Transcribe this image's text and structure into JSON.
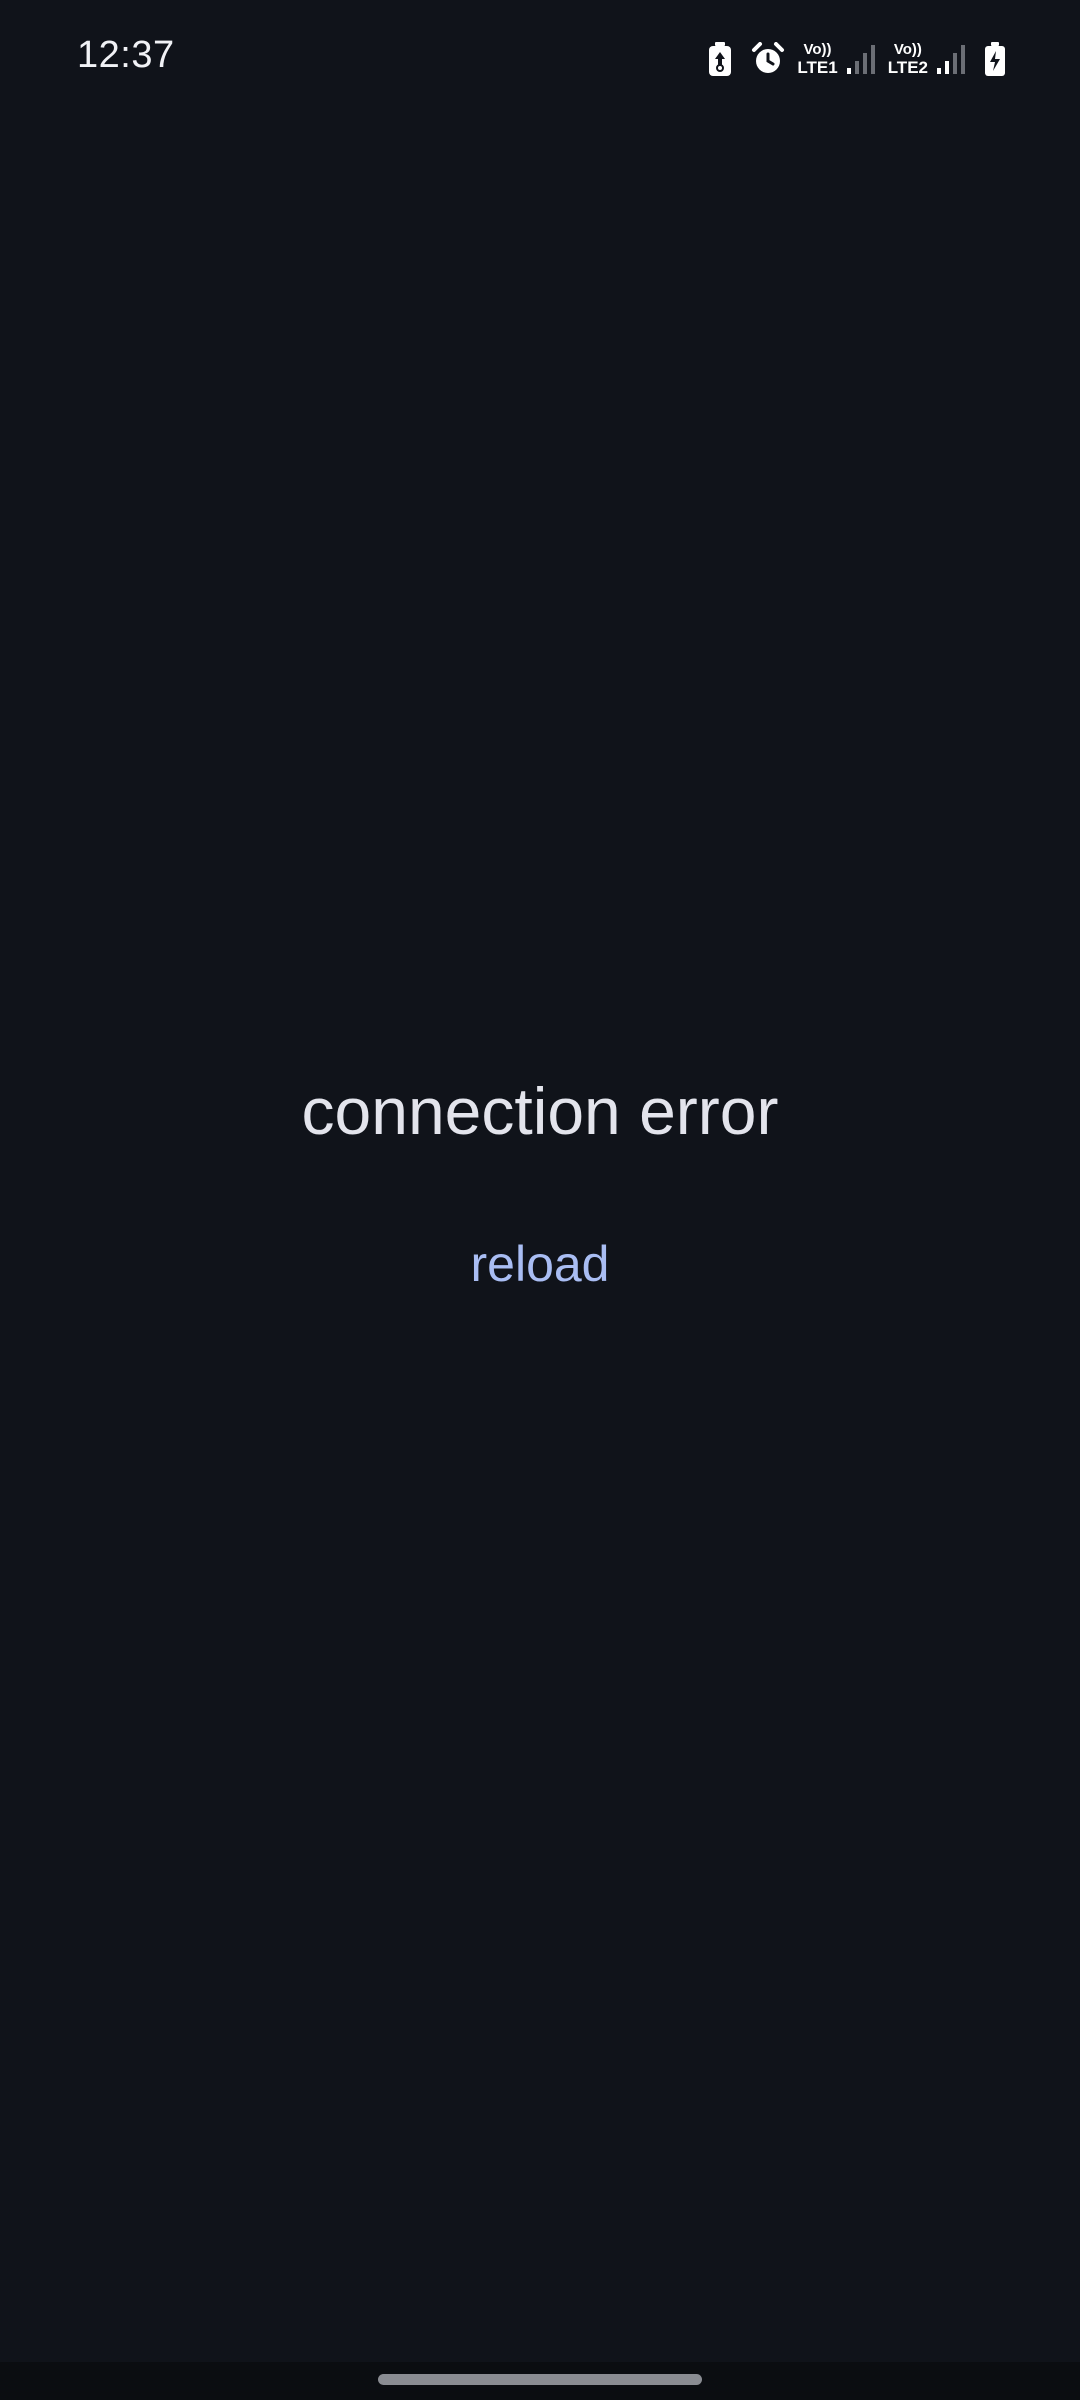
{
  "status_bar": {
    "time": "12:37",
    "icons": [
      "battery-saver-icon",
      "alarm-icon",
      "sim1-signal-icon",
      "sim2-signal-icon",
      "battery-charging-icon"
    ],
    "sim1": {
      "vo": "Vo))",
      "lte": "LTE1"
    },
    "sim2": {
      "vo": "Vo))",
      "lte": "LTE2"
    }
  },
  "main": {
    "error_message": "connection error",
    "reload_label": "reload"
  },
  "colors": {
    "background": "#10131a",
    "text": "#e3e4ec",
    "accent": "#a9bdf3"
  }
}
